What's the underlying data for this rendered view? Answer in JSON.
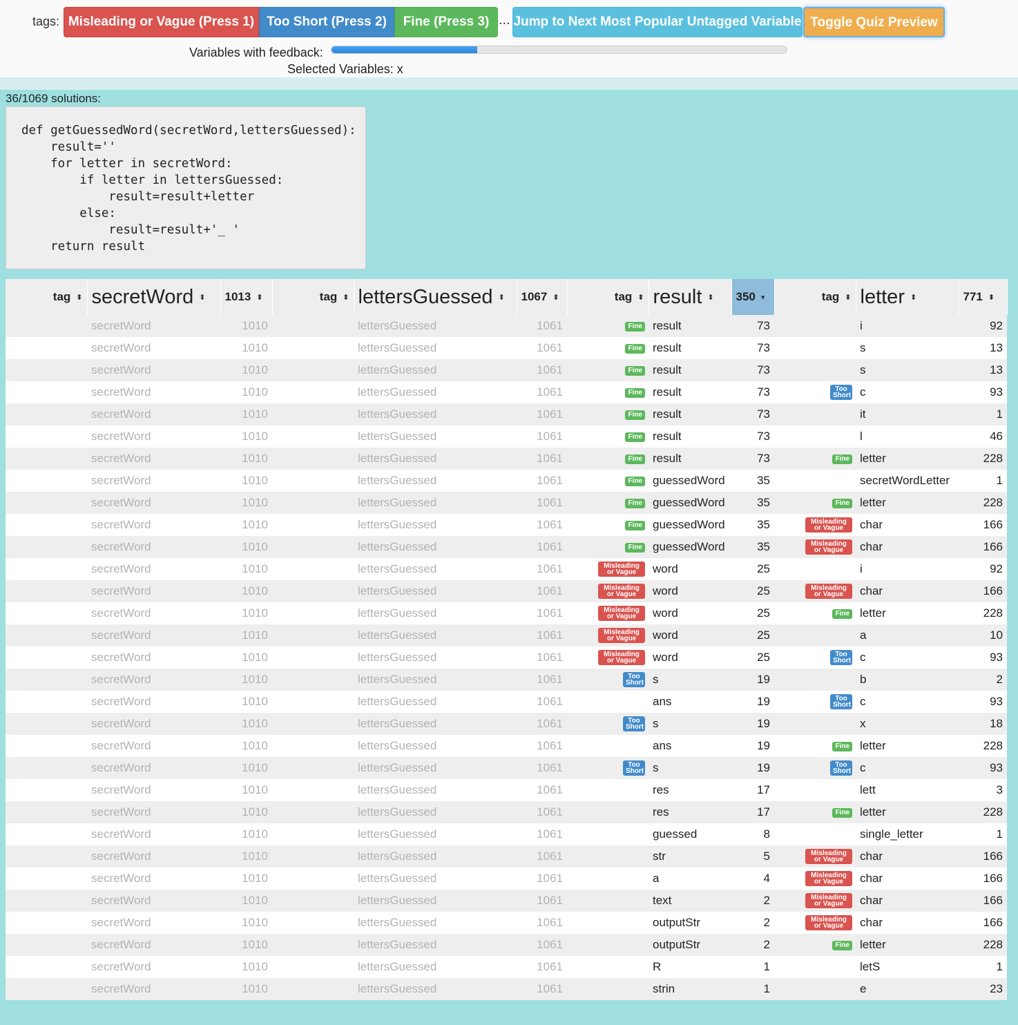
{
  "toolbar": {
    "tags_label": "tags:",
    "btn_misleading": "Misleading or Vague (Press 1)",
    "btn_too_short": "Too Short (Press 2)",
    "btn_fine": "Fine (Press 3)",
    "ellipsis": "...",
    "btn_jump": "Jump to Next Most Popular Untagged Variable",
    "btn_toggle": "Toggle Quiz Preview",
    "feedback_label": "Variables with feedback:",
    "feedback_progress": 0.32,
    "selected_label": "Selected Variables: x"
  },
  "solutions": {
    "count_label": "36/1069 solutions:",
    "code": "def getGuessedWord(secretWord,lettersGuessed):\n    result=''\n    for letter in secretWord:\n        if letter in lettersGuessed:\n            result=result+letter\n        else:\n            result=result+'_ '\n    return result"
  },
  "badges": {
    "fine": "Fine",
    "too_short": [
      "Too",
      "Short"
    ],
    "misleading": [
      "Misleading",
      "or Vague"
    ]
  },
  "table": {
    "headers": [
      {
        "tag": "tag",
        "name": "secretWord",
        "count": "1013"
      },
      {
        "tag": "tag",
        "name": "lettersGuessed",
        "count": "1067"
      },
      {
        "tag": "tag",
        "name": "result",
        "count": "350"
      },
      {
        "tag": "tag",
        "name": "letter",
        "count": "771"
      }
    ],
    "sorted_column": 2,
    "constant": {
      "secretWord": "secretWord",
      "secretWord_count": "1010",
      "lettersGuessed": "lettersGuessed",
      "lettersGuessed_count": "1061"
    },
    "rows": [
      {
        "rtag": "fine",
        "result": "result",
        "rcount": "73",
        "ltag": "",
        "letter": "i",
        "lcount": "92"
      },
      {
        "rtag": "fine",
        "result": "result",
        "rcount": "73",
        "ltag": "",
        "letter": "s",
        "lcount": "13"
      },
      {
        "rtag": "fine",
        "result": "result",
        "rcount": "73",
        "ltag": "",
        "letter": "s",
        "lcount": "13"
      },
      {
        "rtag": "fine",
        "result": "result",
        "rcount": "73",
        "ltag": "short",
        "letter": "c",
        "lcount": "93"
      },
      {
        "rtag": "fine",
        "result": "result",
        "rcount": "73",
        "ltag": "",
        "letter": "it",
        "lcount": "1"
      },
      {
        "rtag": "fine",
        "result": "result",
        "rcount": "73",
        "ltag": "",
        "letter": "l",
        "lcount": "46"
      },
      {
        "rtag": "fine",
        "result": "result",
        "rcount": "73",
        "ltag": "fine",
        "letter": "letter",
        "lcount": "228"
      },
      {
        "rtag": "fine",
        "result": "guessedWord",
        "rcount": "35",
        "ltag": "",
        "letter": "secretWordLetter",
        "lcount": "1"
      },
      {
        "rtag": "fine",
        "result": "guessedWord",
        "rcount": "35",
        "ltag": "fine",
        "letter": "letter",
        "lcount": "228"
      },
      {
        "rtag": "fine",
        "result": "guessedWord",
        "rcount": "35",
        "ltag": "mis",
        "letter": "char",
        "lcount": "166"
      },
      {
        "rtag": "fine",
        "result": "guessedWord",
        "rcount": "35",
        "ltag": "mis",
        "letter": "char",
        "lcount": "166"
      },
      {
        "rtag": "mis",
        "result": "word",
        "rcount": "25",
        "ltag": "",
        "letter": "i",
        "lcount": "92"
      },
      {
        "rtag": "mis",
        "result": "word",
        "rcount": "25",
        "ltag": "mis",
        "letter": "char",
        "lcount": "166"
      },
      {
        "rtag": "mis",
        "result": "word",
        "rcount": "25",
        "ltag": "fine",
        "letter": "letter",
        "lcount": "228"
      },
      {
        "rtag": "mis",
        "result": "word",
        "rcount": "25",
        "ltag": "",
        "letter": "a",
        "lcount": "10"
      },
      {
        "rtag": "mis",
        "result": "word",
        "rcount": "25",
        "ltag": "short",
        "letter": "c",
        "lcount": "93"
      },
      {
        "rtag": "short",
        "result": "s",
        "rcount": "19",
        "ltag": "",
        "letter": "b",
        "lcount": "2"
      },
      {
        "rtag": "",
        "result": "ans",
        "rcount": "19",
        "ltag": "short",
        "letter": "c",
        "lcount": "93"
      },
      {
        "rtag": "short",
        "result": "s",
        "rcount": "19",
        "ltag": "",
        "letter": "x",
        "lcount": "18"
      },
      {
        "rtag": "",
        "result": "ans",
        "rcount": "19",
        "ltag": "fine",
        "letter": "letter",
        "lcount": "228"
      },
      {
        "rtag": "short",
        "result": "s",
        "rcount": "19",
        "ltag": "short",
        "letter": "c",
        "lcount": "93"
      },
      {
        "rtag": "",
        "result": "res",
        "rcount": "17",
        "ltag": "",
        "letter": "lett",
        "lcount": "3"
      },
      {
        "rtag": "",
        "result": "res",
        "rcount": "17",
        "ltag": "fine",
        "letter": "letter",
        "lcount": "228"
      },
      {
        "rtag": "",
        "result": "guessed",
        "rcount": "8",
        "ltag": "",
        "letter": "single_letter",
        "lcount": "1"
      },
      {
        "rtag": "",
        "result": "str",
        "rcount": "5",
        "ltag": "mis",
        "letter": "char",
        "lcount": "166"
      },
      {
        "rtag": "",
        "result": "a",
        "rcount": "4",
        "ltag": "mis",
        "letter": "char",
        "lcount": "166"
      },
      {
        "rtag": "",
        "result": "text",
        "rcount": "2",
        "ltag": "mis",
        "letter": "char",
        "lcount": "166"
      },
      {
        "rtag": "",
        "result": "outputStr",
        "rcount": "2",
        "ltag": "mis",
        "letter": "char",
        "lcount": "166"
      },
      {
        "rtag": "",
        "result": "outputStr",
        "rcount": "2",
        "ltag": "fine",
        "letter": "letter",
        "lcount": "228"
      },
      {
        "rtag": "",
        "result": "R",
        "rcount": "1",
        "ltag": "",
        "letter": "letS",
        "lcount": "1"
      },
      {
        "rtag": "",
        "result": "strin",
        "rcount": "1",
        "ltag": "",
        "letter": "e",
        "lcount": "23"
      }
    ]
  },
  "colors": {
    "fine": "#5cb85c",
    "too_short": "#428bca",
    "misleading": "#d9534f",
    "teal": "#9fdfdf"
  }
}
